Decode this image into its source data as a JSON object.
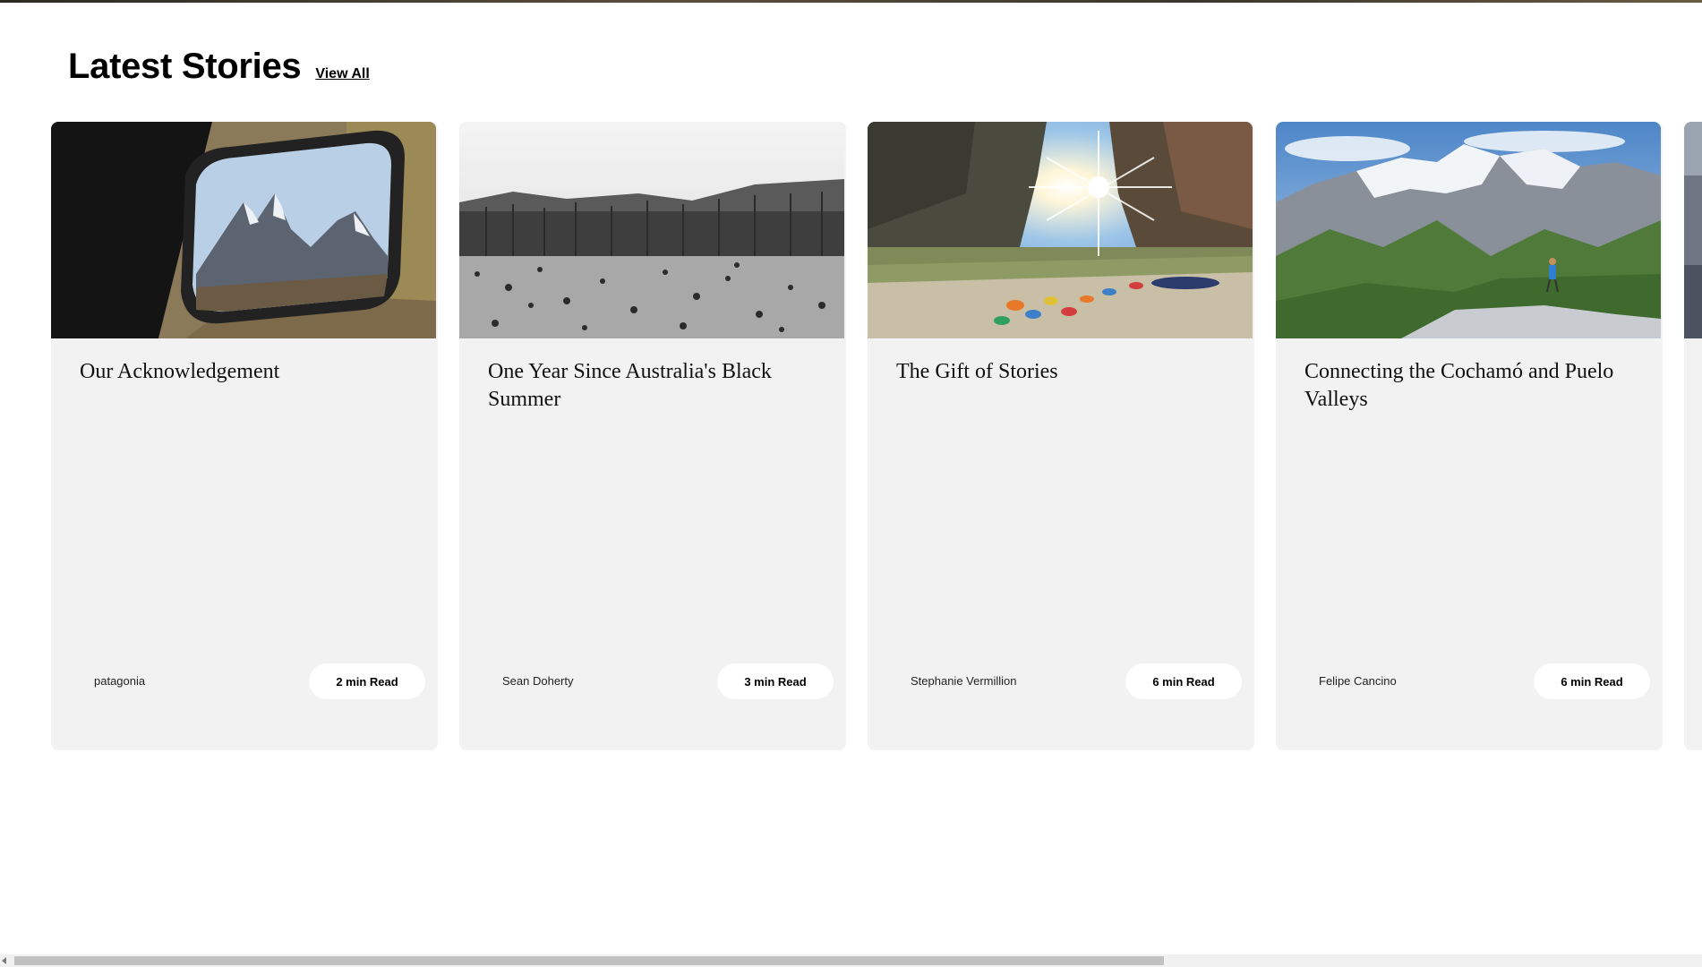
{
  "section": {
    "title": "Latest Stories",
    "view_all_label": "View All"
  },
  "cards": [
    {
      "title": "Our Acknowledgement",
      "author": "patagonia",
      "read_time": "2 min Read",
      "image_icon": "mirror-mountain-photo"
    },
    {
      "title": "One Year Since Australia's Black Summer",
      "author": "Sean Doherty",
      "read_time": "3 min Read",
      "image_icon": "burnt-forest-photo"
    },
    {
      "title": "The Gift of Stories",
      "author": "Stephanie Vermillion",
      "read_time": "6 min Read",
      "image_icon": "river-canyon-sunburst-photo"
    },
    {
      "title": "Connecting the Cochamó and Puelo Valleys",
      "author": "Felipe Cancino",
      "read_time": "6 min Read",
      "image_icon": "snowy-mountains-hiker-photo"
    }
  ],
  "colors": {
    "card_background": "#f2f2f2",
    "pill_background": "#ffffff",
    "text": "#111111"
  }
}
